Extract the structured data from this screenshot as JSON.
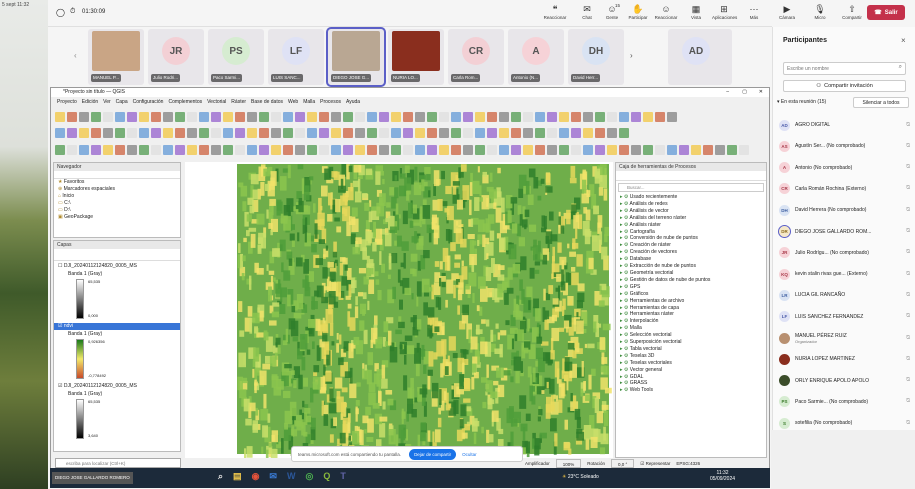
{
  "desktop": {
    "time": "5 sept 11:32"
  },
  "teams": {
    "timer": "01:30:09",
    "toolbar": [
      {
        "label": "Reaccionar",
        "icon": "bubble-icon"
      },
      {
        "label": "Chat",
        "icon": "chat-icon"
      },
      {
        "label": "Gente",
        "icon": "people-icon",
        "badge": "15"
      },
      {
        "label": "Participar",
        "icon": "hand-icon"
      },
      {
        "label": "Reaccionar",
        "icon": "emoji-icon"
      },
      {
        "label": "Vista",
        "icon": "view-icon"
      },
      {
        "label": "Aplicaciones",
        "icon": "apps-icon"
      },
      {
        "label": "Más",
        "icon": "more-icon"
      },
      {
        "label": "Cámara",
        "icon": "camera-icon"
      },
      {
        "label": "Micro",
        "icon": "mic-icon"
      },
      {
        "label": "Compartir",
        "icon": "share-icon"
      }
    ],
    "leave_label": "Salir",
    "gallery": [
      {
        "initials": "",
        "name": "MANUEL P...",
        "color": "#c9a585",
        "photo": true
      },
      {
        "initials": "JR",
        "name": "Julio Rodri...",
        "color": "#f3d0d5"
      },
      {
        "initials": "PS",
        "name": "Paco Sarmi...",
        "color": "#d6ecd1"
      },
      {
        "initials": "LF",
        "name": "LUIS SANC...",
        "color": "#dfe2f5"
      },
      {
        "initials": "",
        "name": "DIEGO JOSE G...",
        "color": "#b9a793",
        "photo": true
      },
      {
        "initials": "",
        "name": "NURIA LO...",
        "color": "#8a2e1e",
        "photo": true
      },
      {
        "initials": "CR",
        "name": "Carla Rom...",
        "color": "#f3d0d5"
      },
      {
        "initials": "A",
        "name": "Antonio (N...",
        "color": "#f6d2d7"
      },
      {
        "initials": "DH",
        "name": "David Herr...",
        "color": "#d9e3f3"
      },
      {
        "initials": "AD",
        "name": "",
        "color": "#dfe2f5"
      }
    ]
  },
  "panel": {
    "title": "Participantes",
    "search_placeholder": "Escribe un nombre",
    "invite_label": "Compartir invitación",
    "section_label": "En esta reunión (15)",
    "mute_all": "Silenciar a todos",
    "participants": [
      {
        "initials": "AD",
        "name": "AGRO DIGITAL",
        "color": "#dfe2f5",
        "fg": "#4a5aa8"
      },
      {
        "initials": "AS",
        "name": "Agustín Ser... (No comprobado)",
        "color": "#f6d2d7",
        "fg": "#a83a4a"
      },
      {
        "initials": "A",
        "name": "Antonio (No comprobado)",
        "color": "#f6d2d7",
        "fg": "#a83a4a"
      },
      {
        "initials": "CR",
        "name": "Carla Román Rochina (Externo)",
        "color": "#f6d2d7",
        "fg": "#a83a4a"
      },
      {
        "initials": "DH",
        "name": "David Herrera (No comprobado)",
        "color": "#d9e3f3",
        "fg": "#3d5ea0"
      },
      {
        "initials": "DR",
        "name": "DIEGO JOSE GALLARDO ROM...",
        "color": "#f5e8c8",
        "fg": "#8a6a1a",
        "ring": true
      },
      {
        "initials": "JR",
        "name": "Julio Rodrígu... (No comprobado)",
        "color": "#f6d2d7",
        "fg": "#a83a4a"
      },
      {
        "initials": "KQ",
        "name": "kevin stalin rivas gue... (Externo)",
        "color": "#f6d2d7",
        "fg": "#a83a4a"
      },
      {
        "initials": "LR",
        "name": "LUCIA GIL RANCAÑO",
        "color": "#d9e3f3",
        "fg": "#3d5ea0"
      },
      {
        "initials": "LF",
        "name": "LUIS SANCHEZ FERNANDEZ",
        "color": "#dfe2f5",
        "fg": "#4a5aa8"
      },
      {
        "initials": "",
        "name": "MANUEL PÉREZ RUIZ",
        "sub": "Organizador",
        "color": "#b89070",
        "fg": "#fff"
      },
      {
        "initials": "",
        "name": "NURIA LOPEZ MARTINEZ",
        "color": "#8a2e1e",
        "fg": "#fff"
      },
      {
        "initials": "",
        "name": "ORLY ENRIQUE APOLO APOLO",
        "color": "#3b4d2a",
        "fg": "#fff"
      },
      {
        "initials": "PS",
        "name": "Paco Sarmie... (No comprobado)",
        "color": "#d6ecd1",
        "fg": "#3a7a2a"
      },
      {
        "initials": "S",
        "name": "sotefilia (No comprobado)",
        "color": "#d6ecd1",
        "fg": "#3a7a2a"
      }
    ]
  },
  "qgis": {
    "title": "*Proyecto sin título — QGIS",
    "menu": [
      "Proyecto",
      "Edición",
      "Ver",
      "Capa",
      "Configuración",
      "Complementos",
      "Vectorial",
      "Ráster",
      "Base de datos",
      "Web",
      "Malla",
      "Procesos",
      "Ayuda"
    ],
    "browser_title": "Navegador",
    "browser_items": [
      "Favoritos",
      "Marcadores espaciales",
      "Inicio",
      "C:\\",
      "D:\\",
      "GeoPackage"
    ],
    "layers_title": "Capas",
    "layers": [
      {
        "name": "DJI_20240112124820_0005_MS",
        "band": "Banda 1 (Gray)",
        "max": "65,535",
        "min": "0,000"
      },
      {
        "name": "ndvi",
        "band": "Banda 1 (Gray)",
        "max": "0,926356",
        "min": "-0,778492"
      },
      {
        "name": "DJI_20240112124820_0005_MS",
        "band": "Banda 1 (Gray)",
        "max": "65,535",
        "min": "3,640"
      }
    ],
    "toolbox_title": "Caja de herramientas de Procesos",
    "toolbox_search": "Buscar...",
    "toolbox_items": [
      "Usado recientemente",
      "Análisis de redes",
      "Análisis de vector",
      "Análisis del terreno ráster",
      "Análisis ráster",
      "Cartografía",
      "Conversión de nube de puntos",
      "Creación de ráster",
      "Creación de vectores",
      "Database",
      "Extracción de nube de puntos",
      "Geometría vectorial",
      "Gestión de datos de nube de puntos",
      "GPS",
      "Gráficos",
      "Herramientas de archivo",
      "Herramientas de capa",
      "Herramientas ráster",
      "Interpolación",
      "Malla",
      "Selección vectorial",
      "Superposición vectorial",
      "Tabla vectorial",
      "Teselas 3D",
      "Teselas vectoriales",
      "Vector general",
      "GDAL",
      "GRASS",
      "Web Tools"
    ],
    "locator_placeholder": "escriba para localizar (Ctrl+K)",
    "share_bar": {
      "text": "teams.microsoft.com está compartiendo tu pantalla.",
      "stop": "Dejar de compartir",
      "hide": "Ocultar"
    },
    "status": {
      "magnifier_label": "Amplificador",
      "magnifier": "100%",
      "rotation_label": "Rotación",
      "rotation": "0,0 °",
      "render": "Representar",
      "crs": "EPSG:4326"
    }
  },
  "taskbar": {
    "user": "DIEGO JOSE GALLARDO ROMERO",
    "weather": "23°C Soleado",
    "time": "11:32",
    "date": "05/09/2024"
  }
}
